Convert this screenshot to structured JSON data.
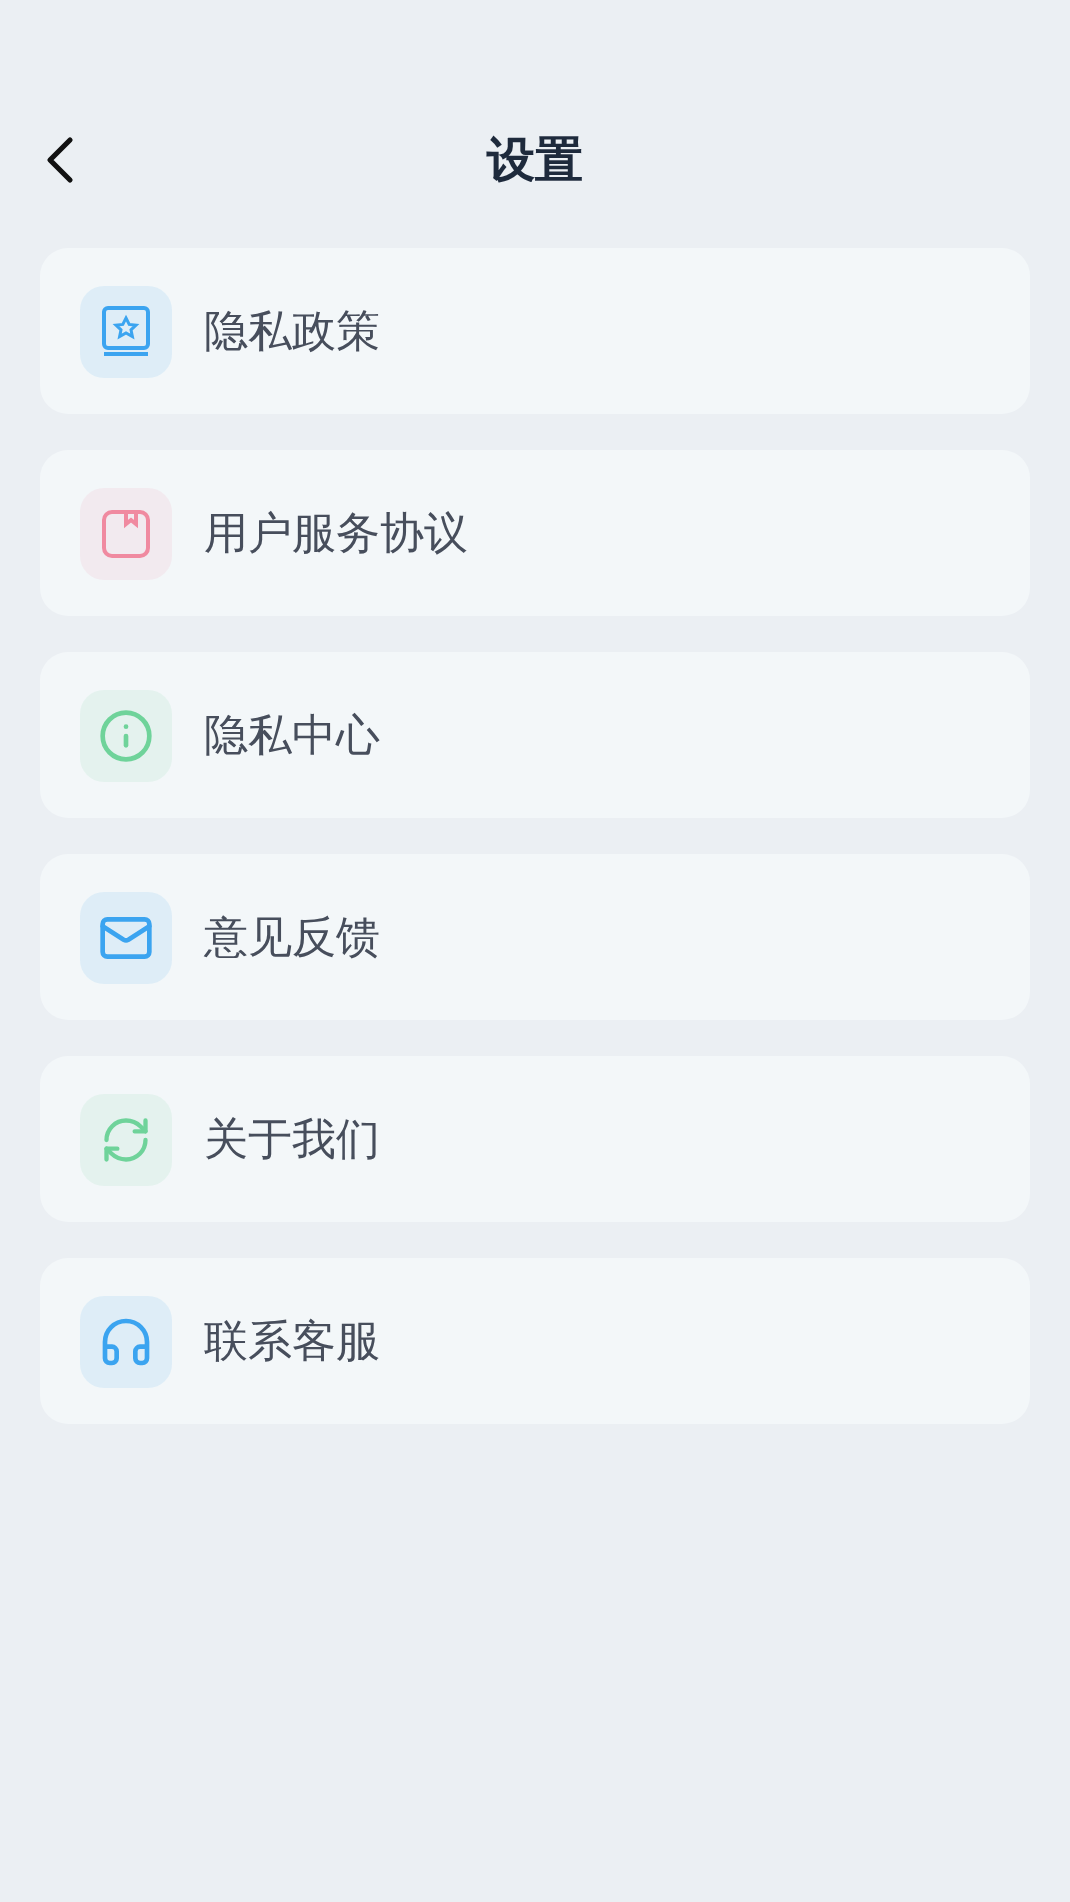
{
  "header": {
    "title": "设置"
  },
  "items": [
    {
      "label": "隐私政策",
      "kind": "book",
      "color": "#3ba4f0"
    },
    {
      "label": "用户服务协议",
      "kind": "bookmark",
      "color": "#f08aa0"
    },
    {
      "label": "隐私中心",
      "kind": "info",
      "color": "#6fd39a"
    },
    {
      "label": "意见反馈",
      "kind": "mail",
      "color": "#3ba4f0"
    },
    {
      "label": "关于我们",
      "kind": "refresh",
      "color": "#6fd39a"
    },
    {
      "label": "联系客服",
      "kind": "headphones",
      "color": "#3ba4f0"
    }
  ]
}
